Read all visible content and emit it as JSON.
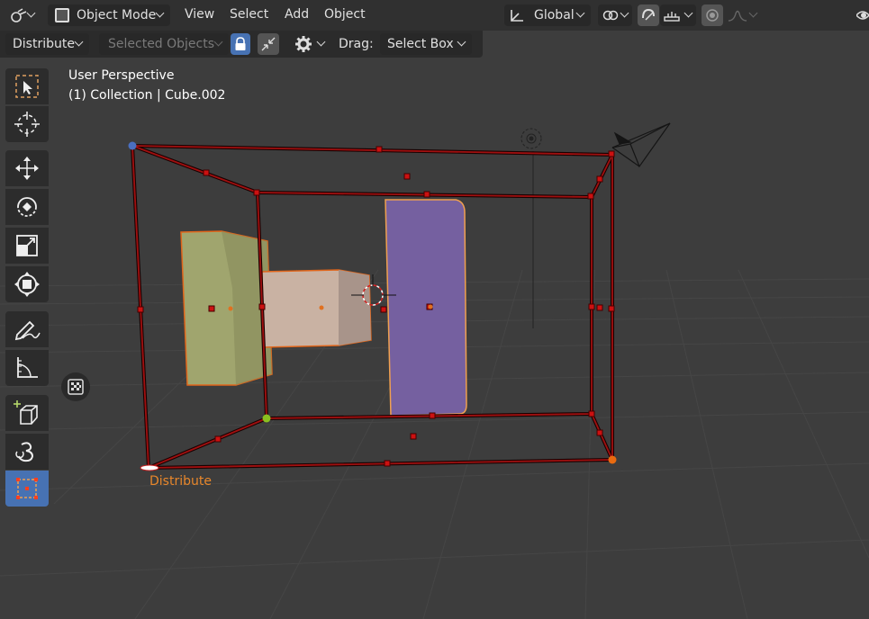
{
  "header": {
    "mode_dropdown": "Object Mode",
    "menus": [
      "View",
      "Select",
      "Add",
      "Object"
    ],
    "transform_orientation": "Global",
    "editor_type_icon": "editor-type-icon",
    "snap_icon": "snap-icon",
    "proportional_icon": "proportional-edit-icon"
  },
  "tool_settings": {
    "operation": "Distribute",
    "target": "Selected Objects",
    "drag_label": "Drag:",
    "drag_value": "Select Box"
  },
  "viewport": {
    "view_name": "User Perspective",
    "object_info": "(1) Collection | Cube.002",
    "operator_label": "Distribute"
  },
  "toolbar": {
    "tools": [
      "select-box",
      "cursor",
      "move",
      "rotate",
      "scale",
      "transform",
      "annotate",
      "measure",
      "add-cube",
      "align-tool",
      "distribute-tool"
    ],
    "active": "distribute-tool"
  },
  "colors": {
    "header_bg": "#303030",
    "viewport_bg": "#3d3d3d",
    "accent_blue": "#4772b3",
    "selection_orange": "#e8872b",
    "cage_red": "#8b0000"
  }
}
